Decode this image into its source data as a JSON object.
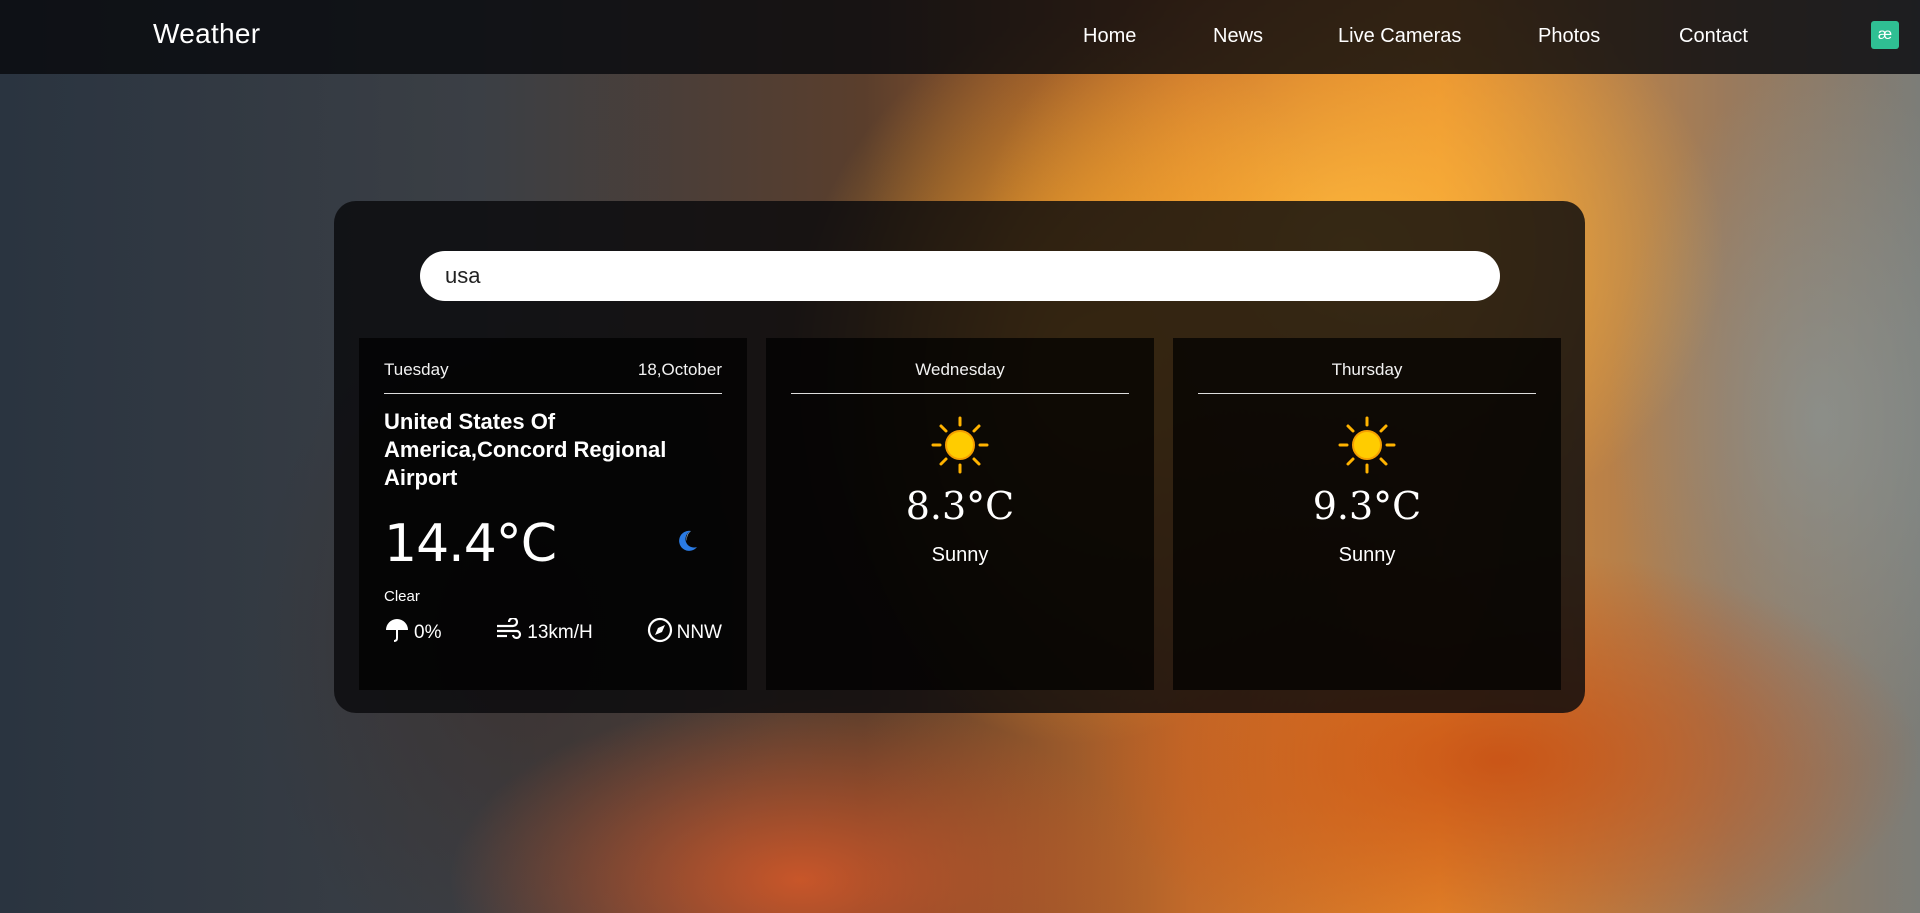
{
  "navbar": {
    "brand": "Weather",
    "links": [
      "Home",
      "News",
      "Live Cameras",
      "Photos",
      "Contact"
    ],
    "badge_glyph": "æ",
    "badge_color": "#2fbf93"
  },
  "search": {
    "value": "usa",
    "placeholder": ""
  },
  "today": {
    "day": "Tuesday",
    "date": "18,October",
    "location": "United States Of America,Concord Regional Airport",
    "temperature": "14.4°C",
    "condition_icon": "moon-icon",
    "condition": "Clear",
    "rain_chance": "0%",
    "wind_speed": "13km/H",
    "wind_direction": "NNW"
  },
  "forecast": [
    {
      "day": "Wednesday",
      "icon": "sun-icon",
      "temperature": "8.3°C",
      "condition": "Sunny"
    },
    {
      "day": "Thursday",
      "icon": "sun-icon",
      "temperature": "9.3°C",
      "condition": "Sunny"
    }
  ],
  "colors": {
    "panel": "#0a0a0c",
    "accent_moon": "#2a7be4",
    "sun": "#ffcc00"
  }
}
